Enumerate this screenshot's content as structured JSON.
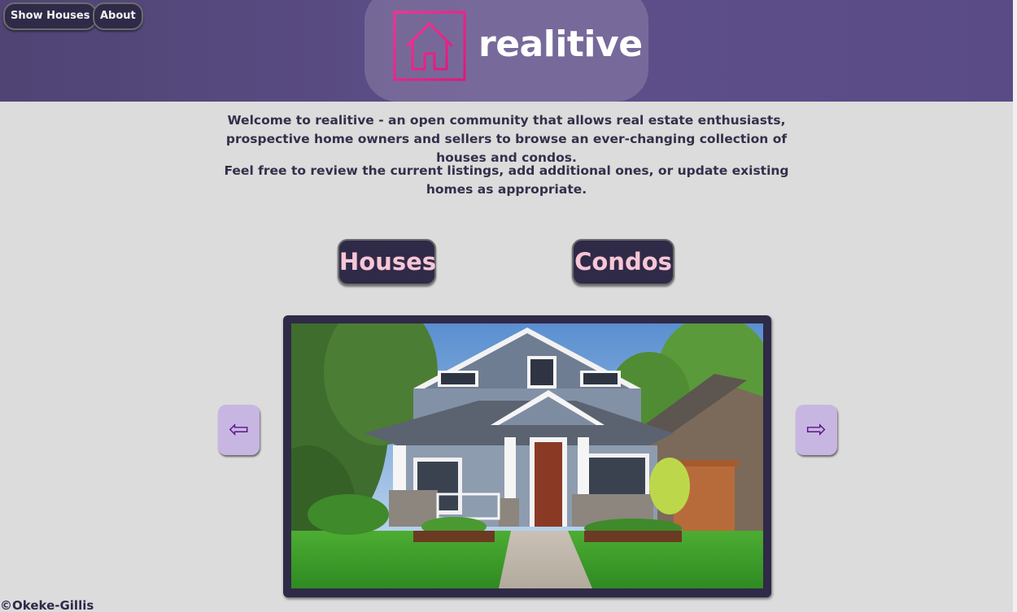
{
  "nav": {
    "show_houses": "Show Houses",
    "about": "About"
  },
  "brand": {
    "name": "realitive",
    "icon": "house-outline-icon",
    "accent": "#ec1d8c"
  },
  "intro": {
    "p1": "Welcome to realitive - an open community that allows real estate enthusiasts, prospective home owners and sellers to browse an ever-changing collection of houses and condos.",
    "p2": "Feel free to review the current listings, add additional ones, or update existing homes as appropriate."
  },
  "categories": {
    "houses": "Houses",
    "condos": "Condos"
  },
  "carousel": {
    "prev_icon": "left-arrow-icon",
    "next_icon": "right-arrow-icon",
    "prev_glyph": "⇦",
    "next_glyph": "⇨",
    "image": "craftsman-house-photo"
  },
  "footer": {
    "copyright": "©Okeke-Gillis"
  },
  "colors": {
    "header": "#5a4b86",
    "button_bg": "#2f2a47",
    "button_text_pink": "#f8c6d6",
    "arrow_bg": "#c7b6e2",
    "page_bg": "#dcdcdc"
  }
}
